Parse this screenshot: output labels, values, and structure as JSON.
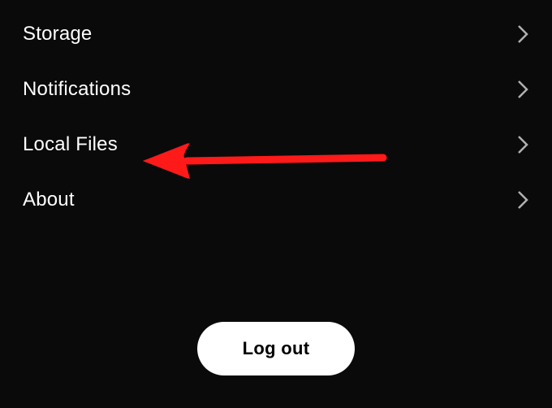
{
  "settings": {
    "items": [
      {
        "label": "Storage"
      },
      {
        "label": "Notifications"
      },
      {
        "label": "Local Files"
      },
      {
        "label": "About"
      }
    ]
  },
  "logout": {
    "label": "Log out"
  },
  "annotation": {
    "type": "arrow-left",
    "color": "#ff1a1a",
    "points_to": "settings-item-local-files"
  }
}
